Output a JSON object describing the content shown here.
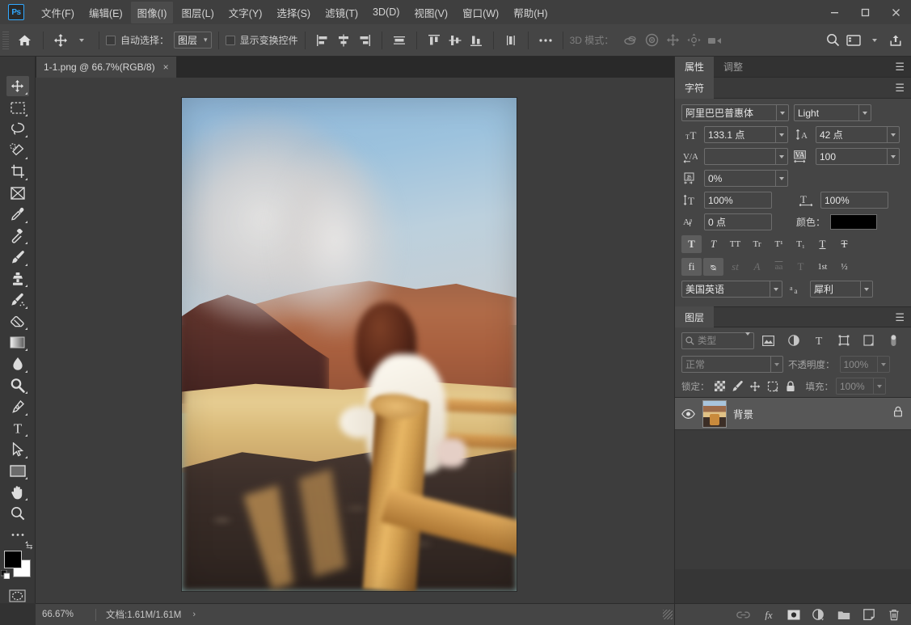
{
  "app": {
    "logo": "Ps",
    "title": "Adobe Photoshop"
  },
  "menubar": {
    "items": [
      {
        "label": "文件(F)",
        "active": false
      },
      {
        "label": "编辑(E)",
        "active": false
      },
      {
        "label": "图像(I)",
        "active": true
      },
      {
        "label": "图层(L)",
        "active": false
      },
      {
        "label": "文字(Y)",
        "active": false
      },
      {
        "label": "选择(S)",
        "active": false
      },
      {
        "label": "滤镜(T)",
        "active": false
      },
      {
        "label": "3D(D)",
        "active": false
      },
      {
        "label": "视图(V)",
        "active": false
      },
      {
        "label": "窗口(W)",
        "active": false
      },
      {
        "label": "帮助(H)",
        "active": false
      }
    ],
    "window_controls": [
      "minimize",
      "maximize",
      "close"
    ]
  },
  "options_bar": {
    "home_icon": "home-icon",
    "tool_icon": "move-tool-icon",
    "auto_select_label": "自动选择：",
    "auto_select_checked": false,
    "auto_select_value": "图层",
    "show_transform_label": "显示变换控件",
    "show_transform_checked": false,
    "align_icons": [
      "align-left-edges",
      "align-horizontal-centers",
      "align-right-edges",
      "distribute-horizontal"
    ],
    "distribute_icons": [
      "align-top-edges",
      "align-vertical-centers",
      "align-bottom-edges",
      "distribute-vertical"
    ],
    "more_icon": "more-options-icon",
    "threeD_label": "3D 模式：",
    "threeD_icons": [
      "rotate-3d-icon",
      "roll-3d-icon",
      "drag-3d-icon",
      "slide-3d-icon",
      "scale-3d-icon"
    ],
    "right_icons": [
      "search-icon",
      "workspace-icon",
      "chevron-down-icon",
      "share-icon"
    ]
  },
  "document_tab": {
    "label": "1-1.png @ 66.7%(RGB/8)",
    "close": "×"
  },
  "toolbar": {
    "tools": [
      {
        "name": "move-tool",
        "icon": "move",
        "active": true,
        "has_more": true
      },
      {
        "name": "marquee-tool",
        "icon": "marquee",
        "active": false,
        "has_more": true
      },
      {
        "name": "lasso-tool",
        "icon": "lasso",
        "active": false,
        "has_more": true
      },
      {
        "name": "quick-selection-tool",
        "icon": "quickselect",
        "active": false,
        "has_more": true
      },
      {
        "name": "crop-tool",
        "icon": "crop",
        "active": false,
        "has_more": true
      },
      {
        "name": "frame-tool",
        "icon": "frame",
        "active": false,
        "has_more": false
      },
      {
        "name": "eyedropper-tool",
        "icon": "eyedropper",
        "active": false,
        "has_more": true
      },
      {
        "name": "spot-healing-brush-tool",
        "icon": "healing",
        "active": false,
        "has_more": true
      },
      {
        "name": "brush-tool",
        "icon": "brush",
        "active": false,
        "has_more": true
      },
      {
        "name": "clone-stamp-tool",
        "icon": "stamp",
        "active": false,
        "has_more": true
      },
      {
        "name": "history-brush-tool",
        "icon": "historybrush",
        "active": false,
        "has_more": true
      },
      {
        "name": "eraser-tool",
        "icon": "eraser",
        "active": false,
        "has_more": true
      },
      {
        "name": "gradient-tool",
        "icon": "gradient",
        "active": false,
        "has_more": true
      },
      {
        "name": "blur-tool",
        "icon": "blur",
        "active": false,
        "has_more": true
      },
      {
        "name": "dodge-tool",
        "icon": "dodge",
        "active": false,
        "has_more": true
      },
      {
        "name": "pen-tool",
        "icon": "pen",
        "active": false,
        "has_more": true
      },
      {
        "name": "type-tool",
        "icon": "type",
        "active": false,
        "has_more": true
      },
      {
        "name": "path-selection-tool",
        "icon": "pathselect",
        "active": false,
        "has_more": true
      },
      {
        "name": "rectangle-tool",
        "icon": "rectangle",
        "active": false,
        "has_more": true
      },
      {
        "name": "hand-tool",
        "icon": "hand",
        "active": false,
        "has_more": true
      },
      {
        "name": "zoom-tool",
        "icon": "zoom",
        "active": false,
        "has_more": false
      },
      {
        "name": "edit-toolbar",
        "icon": "ellipsis",
        "active": false,
        "has_more": true
      }
    ],
    "foreground_color": "#000000",
    "background_color": "#ffffff",
    "quick_mask_icon": "quick-mask-icon"
  },
  "canvas": {
    "zoom": "66.67%",
    "doc_size": "文档:1.61M/1.61M",
    "arrow": "›",
    "image_alt": "blurred photo of a woman at a volcanic crater overlook at sunset"
  },
  "dock": {
    "top_tabs": [
      {
        "label": "属性",
        "active": true
      },
      {
        "label": "调整",
        "active": false
      }
    ],
    "character_panel": {
      "title": "字符",
      "font_family": "阿里巴巴普惠体",
      "font_style": "Light",
      "font_size": "133.1 点",
      "font_size_icon": "font-size-icon",
      "leading": "42 点",
      "leading_icon": "leading-icon",
      "kerning": "",
      "kerning_icon": "kerning-icon",
      "tracking": "100",
      "tracking_icon": "tracking-icon",
      "vertical_scale_icon": "vertical-scale-icon",
      "vertical_scale": "100%",
      "horizontal_scale_icon": "horizontal-scale-icon",
      "horizontal_scale": "100%",
      "baseline_icon": "baseline-shift-icon",
      "baseline_shift": "0 点",
      "tsume_icon": "tsume-icon",
      "tsume": "0%",
      "color_label": "颜色：",
      "color_value": "#000000",
      "style_buttons_row1": [
        {
          "name": "faux-bold",
          "glyph": "T",
          "state": "on"
        },
        {
          "name": "faux-italic",
          "glyph": "T",
          "state": "normal"
        },
        {
          "name": "all-caps",
          "glyph": "TT",
          "state": "normal"
        },
        {
          "name": "small-caps",
          "glyph": "Tr",
          "state": "normal"
        },
        {
          "name": "superscript",
          "glyph": "T¹",
          "state": "normal"
        },
        {
          "name": "subscript",
          "glyph": "T₁",
          "state": "normal"
        },
        {
          "name": "underline",
          "glyph": "T",
          "state": "normal"
        },
        {
          "name": "strikethrough",
          "glyph": "T",
          "state": "normal"
        }
      ],
      "style_buttons_row2": [
        {
          "name": "standard-ligatures",
          "glyph": "fi",
          "state": "on"
        },
        {
          "name": "contextual-alternates",
          "glyph": "ᴓ",
          "state": "on"
        },
        {
          "name": "discretionary-ligatures",
          "glyph": "st",
          "state": "off"
        },
        {
          "name": "swash",
          "glyph": "A",
          "state": "off"
        },
        {
          "name": "oldstyle",
          "glyph": "aa",
          "state": "off"
        },
        {
          "name": "stylistic-alternates",
          "glyph": "T",
          "state": "off"
        },
        {
          "name": "titling-alternates",
          "glyph": "1st",
          "state": "normal"
        },
        {
          "name": "fractions",
          "glyph": "½",
          "state": "normal"
        }
      ],
      "language": "美国英语",
      "antialias_icon": "anti-alias-icon",
      "antialias": "犀利"
    },
    "layers_panel": {
      "title": "图层",
      "filter_placeholder": "类型",
      "filter_icons": [
        "filter-pixel-icon",
        "filter-adjustment-icon",
        "filter-type-icon",
        "filter-shape-icon",
        "filter-smart-icon"
      ],
      "filter_toggle": "filter-toggle-icon",
      "blend_mode": "正常",
      "opacity_label": "不透明度：",
      "opacity_value": "100%",
      "lock_label": "锁定：",
      "lock_icons": [
        "lock-transparent-pixels-icon",
        "lock-image-pixels-icon",
        "lock-position-icon",
        "lock-artboard-nesting-icon",
        "lock-all-icon"
      ],
      "fill_label": "填充：",
      "fill_value": "100%",
      "layers": [
        {
          "name": "背景",
          "visible": true,
          "locked": true
        }
      ],
      "footer_icons": [
        "link-layers-icon",
        "layer-style-fx-icon",
        "layer-mask-icon",
        "adjustment-layer-icon",
        "new-group-icon",
        "new-layer-icon",
        "delete-layer-icon"
      ]
    }
  }
}
